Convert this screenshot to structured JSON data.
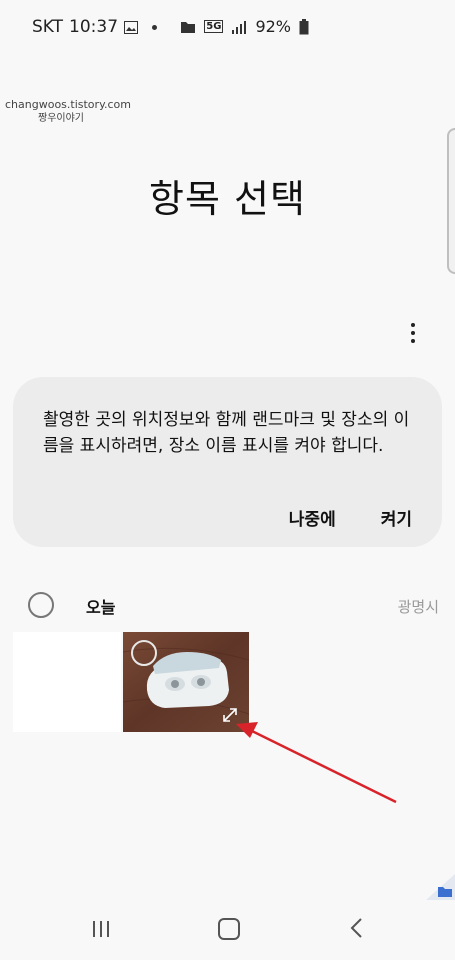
{
  "status_bar": {
    "carrier": "SKT",
    "time": "10:37",
    "network": "5G",
    "battery": "92%"
  },
  "watermark": {
    "line1": "changwoos.tistory.com",
    "line2": "짱우이야기"
  },
  "header": {
    "title": "항목 선택"
  },
  "notice": {
    "message": "촬영한 곳의 위치정보와 함께 랜드마크 및 장소의 이름을 표시하려면, 장소 이름 표시를 켜야 합니다.",
    "later_label": "나중에",
    "enable_label": "켜기"
  },
  "gallery": {
    "date_label": "오늘",
    "location_label": "광명시"
  },
  "colors": {
    "background": "#f8f8f8",
    "card": "#ececec",
    "arrow": "#d8232a"
  }
}
